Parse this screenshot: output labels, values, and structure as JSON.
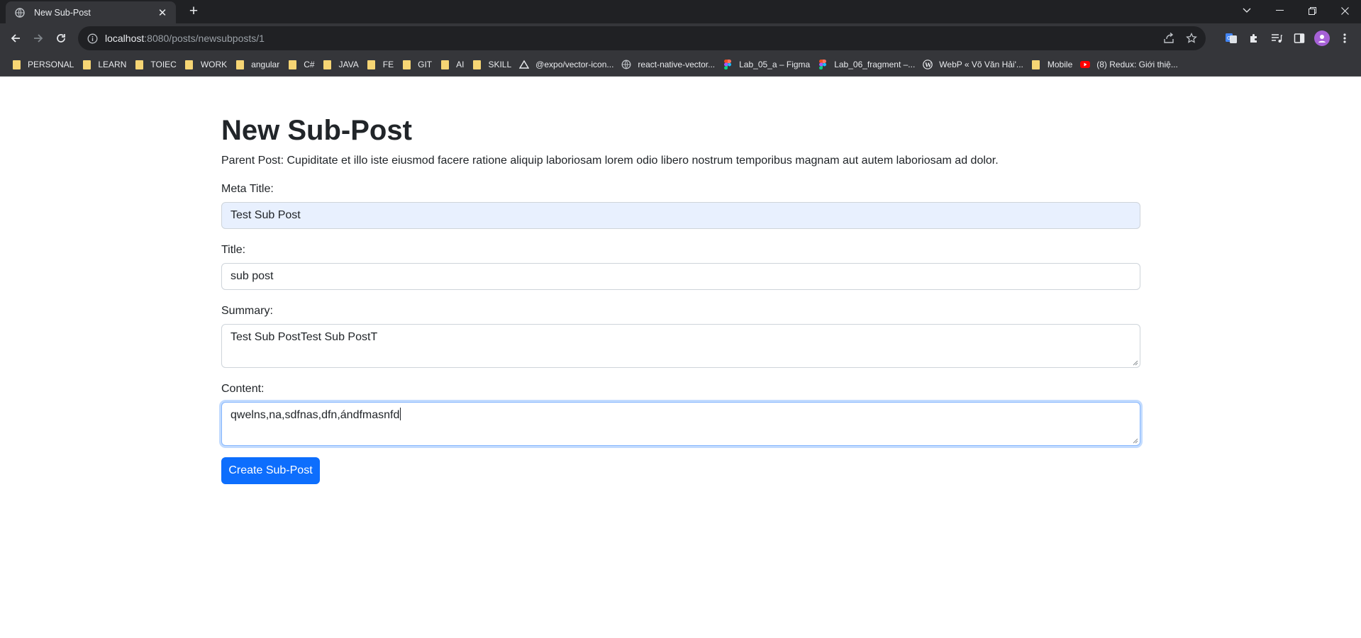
{
  "browser": {
    "tab": {
      "title": "New Sub-Post",
      "favicon": "globe-icon"
    },
    "address": {
      "host": "localhost",
      "rest": ":8080/posts/newsubposts/1"
    },
    "bookmarks": [
      {
        "label": "PERSONAL",
        "icon": "folder-icon"
      },
      {
        "label": "LEARN",
        "icon": "folder-icon"
      },
      {
        "label": "TOIEC",
        "icon": "folder-icon"
      },
      {
        "label": "WORK",
        "icon": "folder-icon"
      },
      {
        "label": "angular",
        "icon": "folder-icon"
      },
      {
        "label": "C#",
        "icon": "folder-icon"
      },
      {
        "label": "JAVA",
        "icon": "folder-icon"
      },
      {
        "label": "FE",
        "icon": "folder-icon"
      },
      {
        "label": "GIT",
        "icon": "folder-icon"
      },
      {
        "label": "AI",
        "icon": "folder-icon"
      },
      {
        "label": "SKILL",
        "icon": "folder-icon"
      },
      {
        "label": "@expo/vector-icon...",
        "icon": "expo-icon"
      },
      {
        "label": "react-native-vector...",
        "icon": "globe-icon"
      },
      {
        "label": "Lab_05_a – Figma",
        "icon": "figma-icon"
      },
      {
        "label": "Lab_06_fragment –...",
        "icon": "figma-icon"
      },
      {
        "label": "WebP « Võ Văn Hải'...",
        "icon": "wordpress-icon"
      },
      {
        "label": "Mobile",
        "icon": "folder-icon"
      },
      {
        "label": "(8) Redux: Giới thiệ...",
        "icon": "youtube-icon"
      }
    ]
  },
  "page": {
    "title": "New Sub-Post",
    "parent_post": "Parent Post: Cupiditate et illo iste eiusmod facere ratione aliquip laboriosam lorem odio libero nostrum temporibus magnam aut autem laboriosam ad dolor.",
    "form": {
      "meta_title": {
        "label": "Meta Title:",
        "value": "Test Sub Post"
      },
      "title": {
        "label": "Title:",
        "value": "sub post"
      },
      "summary": {
        "label": "Summary:",
        "value": "Test Sub PostTest Sub PostT"
      },
      "content": {
        "label": "Content:",
        "value": "qwelns,na,sdfnas,dfn,ándfmasnfd"
      },
      "submit_label": "Create Sub-Post"
    }
  },
  "colors": {
    "primary": "#0d6efd",
    "autofill_bg": "#e8f0fe",
    "chrome_dark": "#202124",
    "chrome_toolbar": "#35363a"
  }
}
